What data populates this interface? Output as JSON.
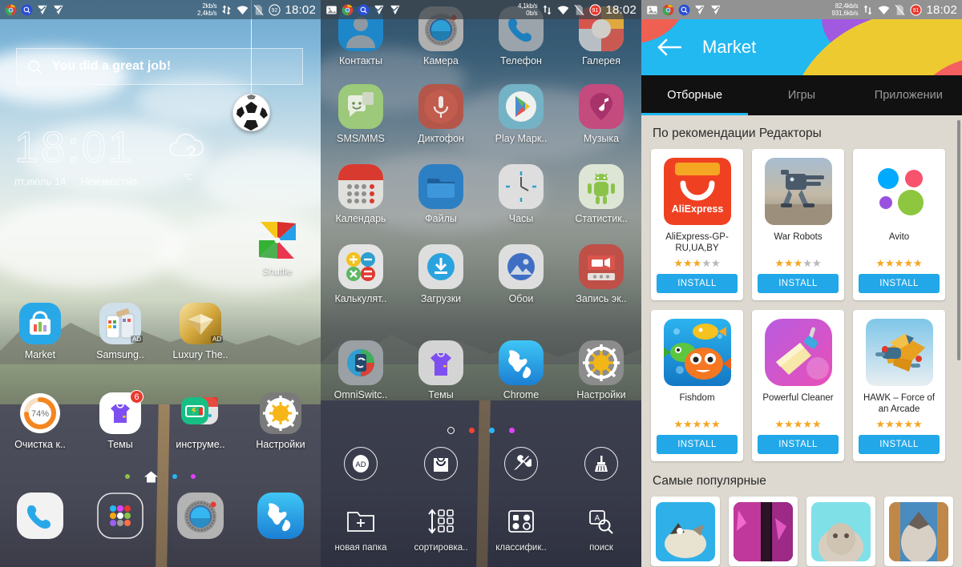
{
  "panels": [
    {
      "name": "home-screen",
      "statusbar": {
        "net_up": "2kb/s",
        "net_down": "2,4kb/s",
        "battery": "92",
        "clock": "18:02",
        "icons": [
          "chrome-icon",
          "search-icon",
          "checkmark-icon",
          "checkmark-icon",
          "sync-arrows-icon",
          "wifi-icon",
          "sim-card-icon",
          "battery-icon"
        ]
      },
      "search_widget": {
        "text": "You did a great job!",
        "icon": "search-icon"
      },
      "clock_widget": {
        "time": "18:01",
        "date": "пт,июль 14",
        "weather": "Неизвестно",
        "unit": "℃"
      },
      "shuffle_widget": {
        "label": "Shuffle"
      },
      "apps_row1": [
        {
          "label": "Market",
          "icon": "market-icon",
          "ad": ""
        },
        {
          "label": "Samsung..",
          "icon": "samsung-theme-icon",
          "ad": "AD"
        },
        {
          "label": "Luxury The..",
          "icon": "luxury-theme-icon",
          "ad": "AD"
        }
      ],
      "apps_row2": [
        {
          "label": "Очистка к..",
          "icon": "cleaner-icon",
          "value": "74%"
        },
        {
          "label": "Темы",
          "icon": "themes-icon",
          "badge": "6"
        },
        {
          "label": "инструме..",
          "icon": "tools-folder-icon",
          "badge": ""
        },
        {
          "label": "Настройки",
          "icon": "settings-gear-icon",
          "badge": ""
        }
      ],
      "page_dots": [
        "#8bc34a",
        "home-icon",
        "#29b6f6",
        "#e040fb"
      ],
      "dock": [
        {
          "label": "",
          "icon": "phone-icon"
        },
        {
          "label": "",
          "icon": "app-drawer-icon"
        },
        {
          "label": "",
          "icon": "camera-icon"
        },
        {
          "label": "",
          "icon": "browser-globe-icon"
        }
      ]
    },
    {
      "name": "app-drawer",
      "statusbar": {
        "net_up": "4,1kb/s",
        "net_down": "0b/s",
        "battery": "91",
        "clock": "18:02",
        "icons": [
          "gallery-icon",
          "chrome-icon",
          "search-icon",
          "checkmark-icon",
          "checkmark-icon",
          "sync-arrows-icon",
          "wifi-icon",
          "sim-card-icon",
          "battery-icon"
        ]
      },
      "apps": [
        {
          "label": "Контакты",
          "icon": "contacts-icon"
        },
        {
          "label": "Камера",
          "icon": "camera-icon"
        },
        {
          "label": "Телефон",
          "icon": "phone-icon"
        },
        {
          "label": "Галерея",
          "icon": "gallery-icon"
        },
        {
          "label": "SMS/MMS",
          "icon": "messaging-icon"
        },
        {
          "label": "Диктофон",
          "icon": "voice-recorder-icon"
        },
        {
          "label": "Play Марк..",
          "icon": "play-store-icon"
        },
        {
          "label": "Музыка",
          "icon": "music-icon"
        },
        {
          "label": "Календарь",
          "icon": "calendar-icon"
        },
        {
          "label": "Файлы",
          "icon": "files-folder-icon"
        },
        {
          "label": "Часы",
          "icon": "clock-icon"
        },
        {
          "label": "Статистик..",
          "icon": "android-stats-icon"
        },
        {
          "label": "Калькулят..",
          "icon": "calculator-icon"
        },
        {
          "label": "Загрузки",
          "icon": "downloads-icon"
        },
        {
          "label": "Обои",
          "icon": "wallpaper-icon"
        },
        {
          "label": "Запись эк..",
          "icon": "screen-recorder-icon"
        },
        {
          "label": "OmniSwitc..",
          "icon": "omniswitch-icon"
        },
        {
          "label": "Темы",
          "icon": "themes-icon"
        },
        {
          "label": "Chrome",
          "icon": "browser-globe-icon"
        },
        {
          "label": "Настройки",
          "icon": "settings-gear-icon"
        }
      ],
      "page_dots": [
        "ring",
        "#f44336",
        "#29b6f6",
        "#e040fb"
      ],
      "tools_row1": [
        {
          "label": "",
          "icon": "ad-icon"
        },
        {
          "label": "",
          "icon": "shopping-bag-icon"
        },
        {
          "label": "",
          "icon": "wrench-tools-icon"
        },
        {
          "label": "",
          "icon": "broom-clean-icon"
        }
      ],
      "tools_row2": [
        {
          "label": "новая папка",
          "icon": "new-folder-icon"
        },
        {
          "label": "сортировка..",
          "icon": "sort-grid-icon"
        },
        {
          "label": "классифик..",
          "icon": "classify-icon"
        },
        {
          "label": "поиск",
          "icon": "search-alpha-icon"
        }
      ]
    },
    {
      "name": "market-app",
      "statusbar": {
        "net_up": "82,4kb/s",
        "net_down": "931,6kb/s",
        "battery": "91",
        "clock": "18:02",
        "icons": [
          "gallery-icon",
          "chrome-icon",
          "search-icon",
          "checkmark-icon",
          "checkmark-icon",
          "sync-arrows-icon",
          "wifi-icon",
          "sim-card-icon",
          "battery-icon"
        ]
      },
      "header": {
        "title": "Market",
        "back_icon": "back-arrow-icon"
      },
      "tabs": [
        {
          "label": "Отборные",
          "active": true
        },
        {
          "label": "Игры",
          "active": false
        },
        {
          "label": "Приложении",
          "active": false
        }
      ],
      "sections": [
        {
          "title": "По рекомендации Редакторы",
          "cards": [
            {
              "name": "AliExpress-GP-RU,UA,BY",
              "icon": "aliexpress-icon",
              "rating": 3,
              "max_rating": 5,
              "install_label": "INSTALL"
            },
            {
              "name": "War Robots",
              "icon": "war-robots-icon",
              "rating": 3,
              "max_rating": 5,
              "install_label": "INSTALL"
            },
            {
              "name": "Avito",
              "icon": "avito-icon",
              "rating": 5,
              "max_rating": 5,
              "install_label": "INSTALL"
            },
            {
              "name": "Fishdom",
              "icon": "fishdom-icon",
              "rating": 5,
              "max_rating": 5,
              "install_label": "INSTALL"
            },
            {
              "name": "Powerful Cleaner",
              "icon": "powerful-cleaner-icon",
              "rating": 5,
              "max_rating": 5,
              "install_label": "INSTALL"
            },
            {
              "name": "HAWK – Force of an Arcade",
              "icon": "hawk-icon",
              "rating": 5,
              "max_rating": 5,
              "install_label": "INSTALL"
            }
          ]
        },
        {
          "title": "Самые популярные",
          "cards": [
            {
              "name": "",
              "icon": "game-thumb-1"
            },
            {
              "name": "",
              "icon": "game-thumb-2"
            },
            {
              "name": "",
              "icon": "game-thumb-3"
            },
            {
              "name": "",
              "icon": "game-thumb-4"
            }
          ]
        }
      ]
    }
  ],
  "colors": {
    "accent_blue": "#22b8f0",
    "install_blue": "#22a7e8",
    "star_on": "#f5a623",
    "star_off": "#b8b8b8",
    "market_bg": "#ddd9d0",
    "tab_bar": "#111111",
    "badge_red": "#e8392e",
    "cleaner_orange": "#f5861f"
  }
}
